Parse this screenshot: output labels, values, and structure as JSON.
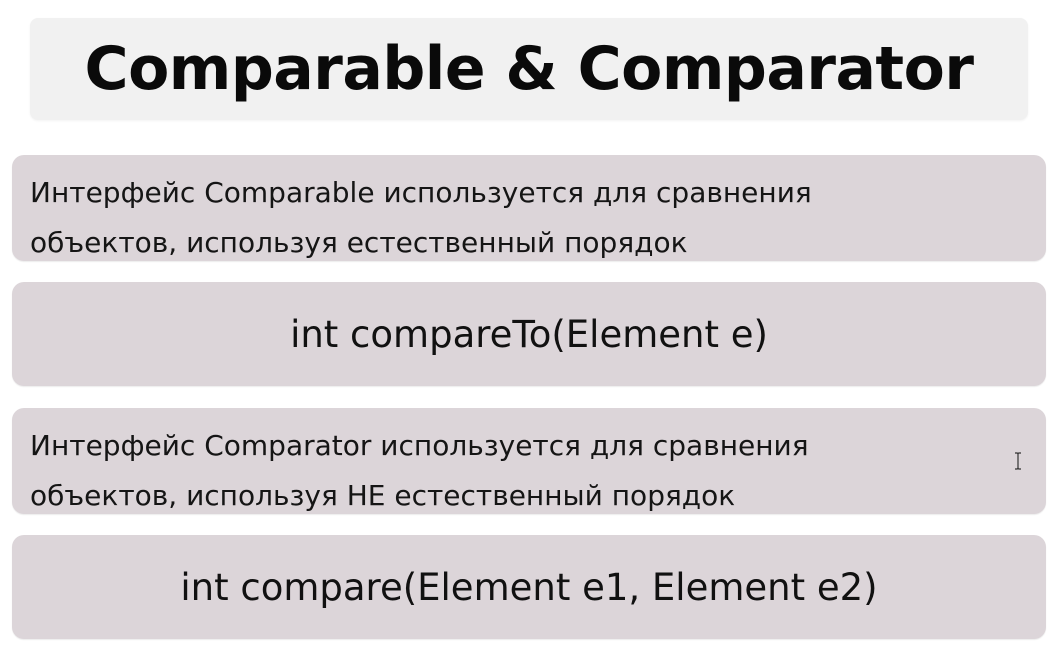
{
  "slide": {
    "title": "Comparable & Comparator",
    "comparable_description": {
      "line1": "Интерфейс Comparable используется для сравнения",
      "line2": "объектов, используя естественный порядок"
    },
    "comparable_method": "int compareTo(Element e)",
    "comparator_description": {
      "line1": "Интерфейс Comparator используется для сравнения",
      "line2": "объектов, используя НЕ естественный порядок"
    },
    "comparator_method": "int compare(Element e1, Element e2)"
  },
  "colors": {
    "title_background": "#f1f1f1",
    "panel_background": "#dcd5d9",
    "text": "#111111"
  },
  "icons": {
    "cursor": "text-cursor-icon"
  }
}
